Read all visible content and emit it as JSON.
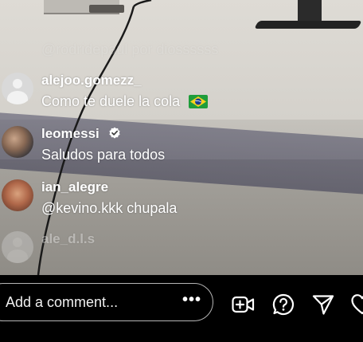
{
  "comments": [
    {
      "username": "",
      "text": "@rodridepaul por diossssss",
      "avatar": "none",
      "state": "faded"
    },
    {
      "username": "alejoo.gomezz_",
      "text": "Como te duele la cola",
      "avatar": "default-avatar",
      "emoji": "brazil-flag-icon"
    },
    {
      "username": "leomessi",
      "text": "Saludos para todos",
      "avatar": "photo",
      "verified": true
    },
    {
      "username": "ian_alegre",
      "text": "@kevino.kkk chupala",
      "avatar": "photo"
    },
    {
      "username": "ale_d.l.s",
      "text": "",
      "avatar": "default-avatar",
      "state": "faded"
    }
  ],
  "bottom_bar": {
    "comment_placeholder": "Add a comment...",
    "more_label": "•••",
    "icons": [
      "add-video-icon",
      "question-icon",
      "send-icon",
      "heart-icon"
    ]
  },
  "colors": {
    "text": "#ffffff",
    "bar_background": "#000000",
    "input_border": "#b5b5b5"
  }
}
